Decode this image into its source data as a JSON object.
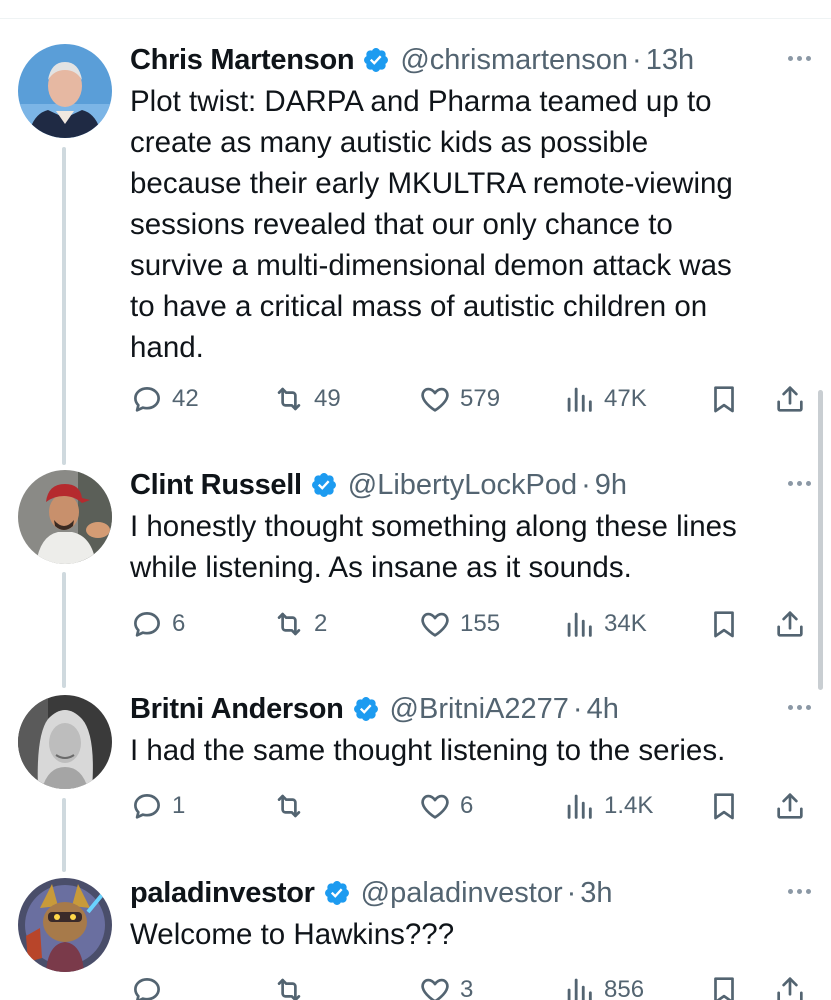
{
  "tweets": [
    {
      "name": "Chris Martenson",
      "handle": "@chrismartenson",
      "time": "13h",
      "text_lines": [
        "Plot twist:  DARPA and Pharma teamed up to",
        "create as many autistic kids as possible",
        "because their early MKULTRA remote-viewing",
        "sessions revealed that our only chance to",
        "survive a multi-dimensional demon attack was",
        "to have a critical mass of autistic children on",
        "hand."
      ],
      "replies": "42",
      "reposts": "49",
      "likes": "579",
      "views": "47K"
    },
    {
      "name": "Clint Russell",
      "handle": "@LibertyLockPod",
      "time": "9h",
      "text_lines": [
        "I honestly thought something along these lines",
        "while listening. As insane as it sounds."
      ],
      "replies": "6",
      "reposts": "2",
      "likes": "155",
      "views": "34K"
    },
    {
      "name": "Britni Anderson",
      "handle": "@BritniA2277",
      "time": "4h",
      "text_lines": [
        "I had the same thought listening to the series."
      ],
      "replies": "1",
      "reposts": "",
      "likes": "6",
      "views": "1.4K"
    },
    {
      "name": "paladinvestor",
      "handle": "@paladinvestor",
      "time": "3h",
      "text_lines": [
        "Welcome to Hawkins???"
      ],
      "replies": "",
      "reposts": "",
      "likes": "3",
      "views": "856"
    }
  ],
  "separator": "·",
  "icons": {
    "verified": "verified-badge-icon",
    "more": "more-options-icon",
    "reply": "reply-icon",
    "repost": "repost-icon",
    "like": "heart-icon",
    "views": "views-icon",
    "bookmark": "bookmark-icon",
    "share": "share-icon"
  },
  "colors": {
    "verified_blue": "#1d9bf0",
    "text": "#0f1419",
    "secondary": "#536471",
    "thread_line": "#cfd9de"
  }
}
